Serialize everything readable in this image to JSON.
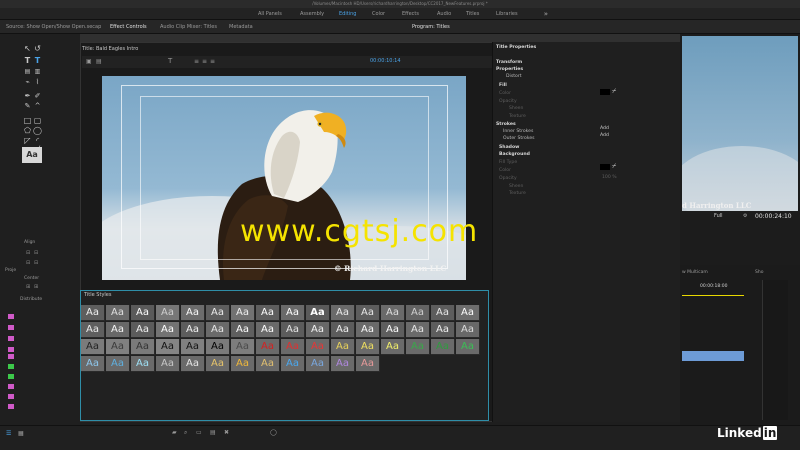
{
  "window_title": "/Volumes/Macintosh HD/Users/richardharrington/Desktop/CC2017_NewFeatures.prproj *",
  "workspaces": [
    {
      "label": "All Panels"
    },
    {
      "label": "Assembly"
    },
    {
      "label": "Editing",
      "active": true
    },
    {
      "label": "Color"
    },
    {
      "label": "Effects"
    },
    {
      "label": "Audio"
    },
    {
      "label": "Titles"
    },
    {
      "label": "Libraries"
    }
  ],
  "workspaces_more": "»",
  "panel_tabs": {
    "source": "Source: Show Open/Show Open.secap",
    "effect_controls": "Effect Controls",
    "audio_clip_mixer": "Audio Clip Mixer: Titles",
    "metadata": "Metadata",
    "program": "Program: Titles"
  },
  "designer": {
    "title": "Title: Bald Eagles Intro",
    "timecode": "00:00:10:14"
  },
  "left_labels": {
    "align": "Align",
    "center": "Center",
    "distribute": "Distribute",
    "project_tab": "Proje"
  },
  "aa_sample": "Aa",
  "canvas_overlay": {
    "watermark": "www.cgtsj.com",
    "copyright": "© Richard Harrington LLC"
  },
  "title_styles": {
    "header": "Title Styles",
    "sample": "Aa",
    "swatches": [
      {
        "bg": "#5e5e5e",
        "fg": "#f0f0f0"
      },
      {
        "bg": "#6a6a6a",
        "fg": "#e0e0e0"
      },
      {
        "bg": "#5a5a5a",
        "fg": "#ffffff"
      },
      {
        "bg": "#777",
        "fg": "#cfcfcf"
      },
      {
        "bg": "#6c6c6c",
        "fg": "#fafafa"
      },
      {
        "bg": "#5e5e5e",
        "fg": "#ececec"
      },
      {
        "bg": "#727272",
        "fg": "#f0f0f0"
      },
      {
        "bg": "#5e5e5e",
        "fg": "#ffffff"
      },
      {
        "bg": "#6a6a6a",
        "fg": "#ffffff"
      },
      {
        "bg": "#5a5a5a",
        "fg": "#ffffff"
      },
      {
        "bg": "#6a6a6a",
        "fg": "#eaeaea"
      },
      {
        "bg": "#5d5d5d",
        "fg": "#e8e8e8"
      },
      {
        "bg": "#6a6a6a",
        "fg": "#dedede"
      },
      {
        "bg": "#636363",
        "fg": "#d0d0d0"
      },
      {
        "bg": "#5d5d5d",
        "fg": "#e8e8e8"
      },
      {
        "bg": "#6d6d6d",
        "fg": "#ffffff"
      },
      {
        "bg": "#5f5f5f",
        "fg": "#ececec"
      },
      {
        "bg": "#686868",
        "fg": "#f5f5f5"
      },
      {
        "bg": "#5c5c5c",
        "fg": "#f0f0f0"
      },
      {
        "bg": "#737373",
        "fg": "#ffffff"
      },
      {
        "bg": "#5d5d5d",
        "fg": "#f2f2f2"
      },
      {
        "bg": "#6a6a6a",
        "fg": "#e6e6e6"
      },
      {
        "bg": "#5f5f5f",
        "fg": "#ffffff"
      },
      {
        "bg": "#6a6a6a",
        "fg": "#ffffff"
      },
      {
        "bg": "#5c5c5c",
        "fg": "#e6e6e6"
      },
      {
        "bg": "#686868",
        "fg": "#f2f2f2"
      },
      {
        "bg": "#5c5c5c",
        "fg": "#f0f0f0"
      },
      {
        "bg": "#6a6a6a",
        "fg": "#fafafa"
      },
      {
        "bg": "#5e5e5e",
        "fg": "#ffffff"
      },
      {
        "bg": "#6a6a6a",
        "fg": "#e6e6e6"
      },
      {
        "bg": "#5d5d5d",
        "fg": "#f0f0f0"
      },
      {
        "bg": "#686868",
        "fg": "#dcdcdc"
      },
      {
        "bg": "#7b7b7b",
        "fg": "#222222"
      },
      {
        "bg": "#808080",
        "fg": "#3a3a3a"
      },
      {
        "bg": "#7a7a7a",
        "fg": "#333333"
      },
      {
        "bg": "#858585",
        "fg": "#111111"
      },
      {
        "bg": "#808080",
        "fg": "#111111"
      },
      {
        "bg": "#7a7a7a",
        "fg": "#000000"
      },
      {
        "bg": "#7d7d7d",
        "fg": "#4a4a4a"
      },
      {
        "bg": "#6a6a6a",
        "fg": "#d42020"
      },
      {
        "bg": "#6a6a6a",
        "fg": "#e03030"
      },
      {
        "bg": "#6a6a6a",
        "fg": "#e83535"
      },
      {
        "bg": "#6a6a6a",
        "fg": "#e8d25a"
      },
      {
        "bg": "#6a6a6a",
        "fg": "#f0e060"
      },
      {
        "bg": "#6a6a6a",
        "fg": "#f2f06a"
      },
      {
        "bg": "#6a6a6a",
        "fg": "#3aa84a"
      },
      {
        "bg": "#6a6a6a",
        "fg": "#2e9c3e"
      },
      {
        "bg": "#6a6a6a",
        "fg": "#3bbf55"
      },
      {
        "bg": "#6a6a6a",
        "fg": "#8ec8ee"
      },
      {
        "bg": "#6a6a6a",
        "fg": "#5fb0e0"
      },
      {
        "bg": "#6a6a6a",
        "fg": "#9ee0f5"
      },
      {
        "bg": "#6a6a6a",
        "fg": "#c8c8c8"
      },
      {
        "bg": "#6a6a6a",
        "fg": "#e6e6e6"
      },
      {
        "bg": "#6a6a6a",
        "fg": "#e8c56a"
      },
      {
        "bg": "#6a6a6a",
        "fg": "#f0b83a"
      },
      {
        "bg": "#6a6a6a",
        "fg": "#e2c070"
      },
      {
        "bg": "#6a6a6a",
        "fg": "#4aa8f0"
      },
      {
        "bg": "#6a6a6a",
        "fg": "#7aa8e0"
      },
      {
        "bg": "#6a6a6a",
        "fg": "#b088e0"
      },
      {
        "bg": "#6a6a6a",
        "fg": "#e89a9a"
      }
    ]
  },
  "title_properties": {
    "header": "Title Properties",
    "rows": [
      {
        "text": "Transform",
        "style": "bold"
      },
      {
        "text": "Properties",
        "style": "bold"
      },
      {
        "text": "Distort",
        "style": "normal"
      },
      {
        "text": "Fill",
        "style": "bold"
      },
      {
        "text": "Color",
        "style": "dim"
      },
      {
        "text": "Opacity",
        "style": "dim"
      },
      {
        "text": "Sheen",
        "style": "dim"
      },
      {
        "text": "Texture",
        "style": "dim"
      },
      {
        "text": "Strokes",
        "style": "bold"
      },
      {
        "text": "Inner Strokes",
        "style": "normal"
      },
      {
        "text": "Outer Strokes",
        "style": "normal"
      },
      {
        "text": "Shadow",
        "style": "bold"
      },
      {
        "text": "Background",
        "style": "bold"
      },
      {
        "text": "Fill Type",
        "style": "dim"
      },
      {
        "text": "Color",
        "style": "dim"
      },
      {
        "text": "Opacity",
        "style": "dim"
      },
      {
        "text": "Sheen",
        "style": "dim"
      },
      {
        "text": "Texture",
        "style": "dim"
      }
    ],
    "add_inner": "Add",
    "add_outer": "Add",
    "opacity_value": "100 %"
  },
  "program": {
    "copyright": "d Harrington LLC",
    "zoom": "Full",
    "timecode": "00:00:24:10",
    "multicam_tab": "w Multicam",
    "sho_tab": "Sho",
    "sequence_timecode": "00:00:18:00"
  },
  "brand": {
    "linked": "Linked",
    "in": "in"
  },
  "colors": {
    "accent": "#4aa3e8",
    "selection_border": "#2f8ea8",
    "watermark": "#f5e300"
  }
}
